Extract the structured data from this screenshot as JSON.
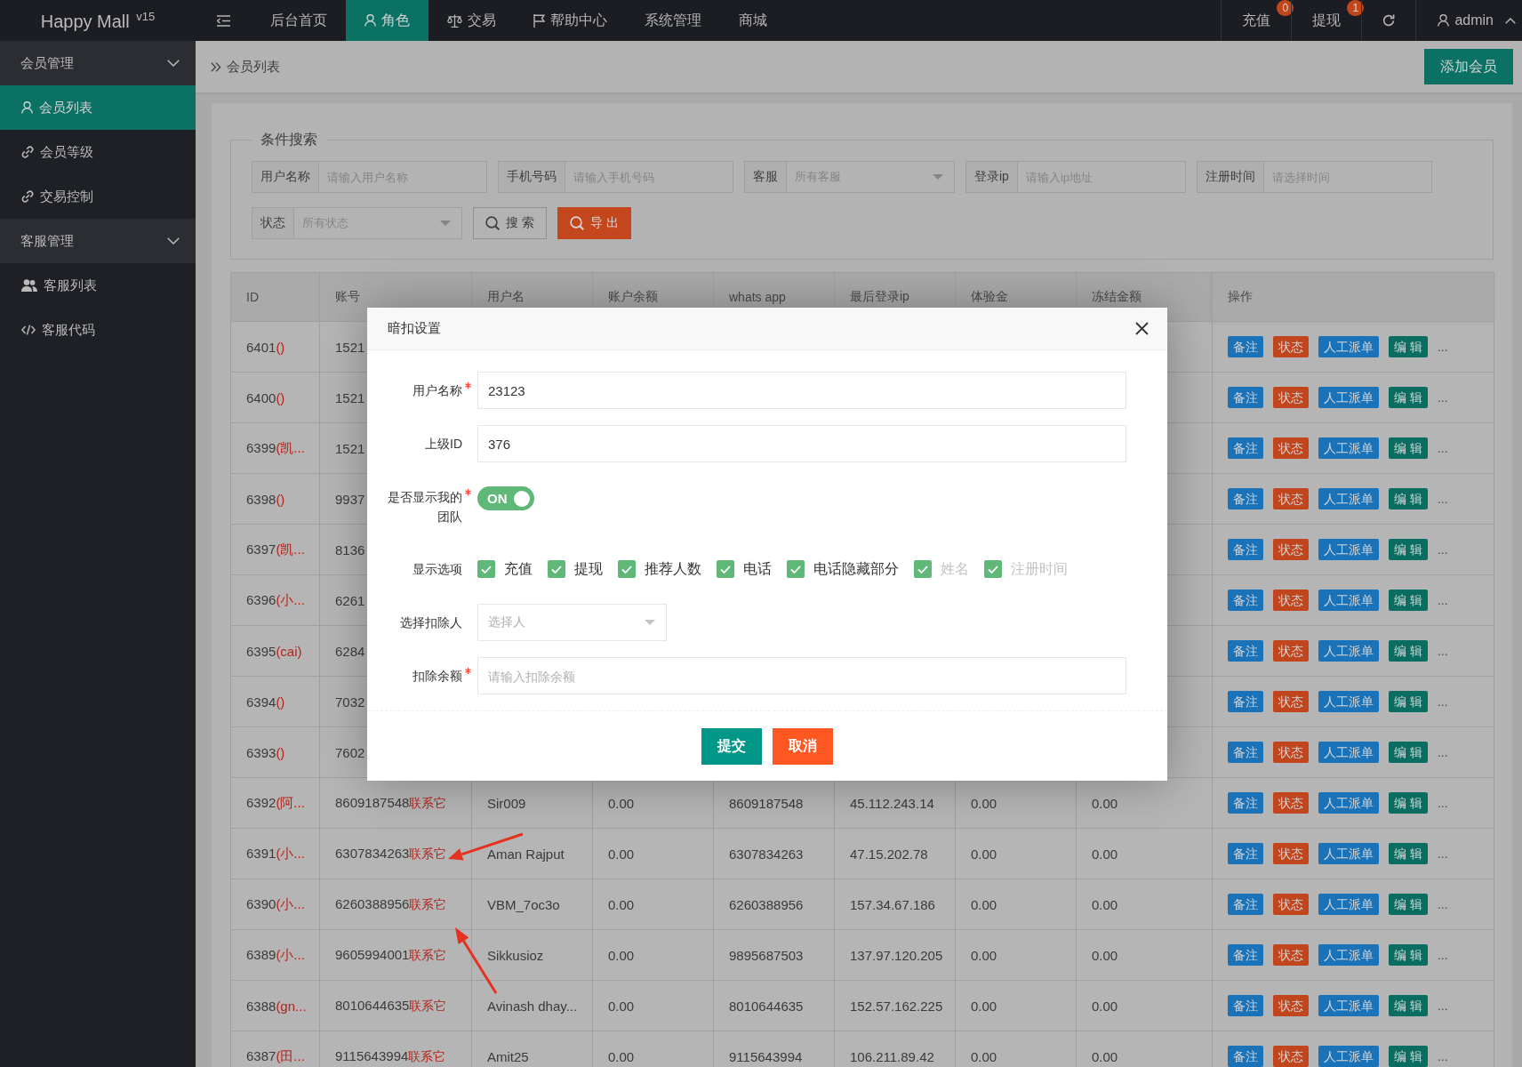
{
  "header": {
    "logo": "Happy Mall $^{v15}$",
    "nav": [
      {
        "label": "后台首页",
        "selected": false
      },
      {
        "label": "角色",
        "selected": true
      },
      {
        "label": "交易",
        "selected": false
      },
      {
        "label": "帮助中心",
        "selected": false
      },
      {
        "label": "系统管理",
        "selected": false
      },
      {
        "label": "商城",
        "selected": false
      }
    ],
    "actions": [
      {
        "kind": "link",
        "label": "充值",
        "badge": "0"
      },
      {
        "kind": "link",
        "label": "提现",
        "badge": "1"
      },
      {
        "kind": "refresh"
      },
      {
        "kind": "user",
        "label": "admin"
      }
    ]
  },
  "sidebar": [
    {
      "label": "会员管理",
      "expanded": true,
      "children": [
        {
          "label": "会员列表",
          "selected": true
        },
        {
          "label": "会员等级",
          "selected": false
        },
        {
          "label": "交易控制",
          "selected": false
        }
      ]
    },
    {
      "label": "客服管理",
      "expanded": true,
      "children": [
        {
          "label": "客服列表",
          "selected": false
        },
        {
          "label": "客服代码",
          "selected": false
        }
      ]
    }
  ],
  "breadcrumb": {
    "current": "会员列表",
    "button": "添加会员"
  },
  "search": {
    "legend": "条件搜索",
    "fields": [
      {
        "kind": "input",
        "label": "用户名称",
        "placeholder": "请输入用户名称"
      },
      {
        "kind": "input",
        "label": "手机号码",
        "placeholder": "请输入手机号码"
      },
      {
        "kind": "select",
        "label": "客服",
        "placeholder": "所有客服"
      },
      {
        "kind": "input",
        "label": "登录ip",
        "placeholder": "请输入ip地址"
      },
      {
        "kind": "input",
        "label": "注册时间",
        "placeholder": "请选择时间"
      },
      {
        "kind": "select",
        "label": "状态",
        "placeholder": "所有状态"
      }
    ],
    "buttons": [
      {
        "kind": "default",
        "label": "搜 索"
      },
      {
        "kind": "danger",
        "label": "导 出"
      }
    ]
  },
  "table": {
    "columns": [
      "ID",
      "账号",
      "用户名",
      "账户余额",
      "whats app",
      "最后登录ip",
      "体验金",
      "冻结金额",
      "操作"
    ],
    "rows": [
      {
        "id": "6401",
        "nick": "()",
        "account": "1521",
        "actions": [
          {
            "label": "备注",
            "kind": "normal"
          },
          {
            "label": "状态",
            "kind": "danger"
          },
          {
            "label": "人工派单",
            "kind": "normal"
          },
          {
            "label": "编 辑",
            "kind": "success"
          },
          {
            "label": "...",
            "kind": "more"
          }
        ]
      },
      {
        "id": "6400",
        "nick": "()",
        "account": "1521",
        "actions": [
          {
            "label": "备注",
            "kind": "normal"
          },
          {
            "label": "状态",
            "kind": "danger"
          },
          {
            "label": "人工派单",
            "kind": "normal"
          },
          {
            "label": "编 辑",
            "kind": "success"
          },
          {
            "label": "...",
            "kind": "more"
          }
        ]
      },
      {
        "id": "6399",
        "nick": "(凯...",
        "account": "1521",
        "actions": [
          {
            "label": "备注",
            "kind": "normal"
          },
          {
            "label": "状态",
            "kind": "danger"
          },
          {
            "label": "人工派单",
            "kind": "normal"
          },
          {
            "label": "编 辑",
            "kind": "success"
          },
          {
            "label": "...",
            "kind": "more"
          }
        ]
      },
      {
        "id": "6398",
        "nick": "()",
        "account": "9937",
        "actions": [
          {
            "label": "备注",
            "kind": "normal"
          },
          {
            "label": "状态",
            "kind": "danger"
          },
          {
            "label": "人工派单",
            "kind": "normal"
          },
          {
            "label": "编 辑",
            "kind": "success"
          },
          {
            "label": "...",
            "kind": "more"
          }
        ]
      },
      {
        "id": "6397",
        "nick": "(凯...",
        "account": "8136",
        "actions": [
          {
            "label": "备注",
            "kind": "normal"
          },
          {
            "label": "状态",
            "kind": "danger"
          },
          {
            "label": "人工派单",
            "kind": "normal"
          },
          {
            "label": "编 辑",
            "kind": "success"
          },
          {
            "label": "...",
            "kind": "more"
          }
        ]
      },
      {
        "id": "6396",
        "nick": "(小...",
        "account": "6261",
        "actions": [
          {
            "label": "备注",
            "kind": "normal"
          },
          {
            "label": "状态",
            "kind": "danger"
          },
          {
            "label": "人工派单",
            "kind": "normal"
          },
          {
            "label": "编 辑",
            "kind": "success"
          },
          {
            "label": "...",
            "kind": "more"
          }
        ]
      },
      {
        "id": "6395",
        "nick": "(cai)",
        "account": "6284",
        "actions": [
          {
            "label": "备注",
            "kind": "normal"
          },
          {
            "label": "状态",
            "kind": "danger"
          },
          {
            "label": "人工派单",
            "kind": "normal"
          },
          {
            "label": "编 辑",
            "kind": "success"
          },
          {
            "label": "...",
            "kind": "more"
          }
        ]
      },
      {
        "id": "6394",
        "nick": "()",
        "account": "7032",
        "actions": [
          {
            "label": "备注",
            "kind": "normal"
          },
          {
            "label": "状态",
            "kind": "danger"
          },
          {
            "label": "人工派单",
            "kind": "normal"
          },
          {
            "label": "编 辑",
            "kind": "success"
          },
          {
            "label": "...",
            "kind": "more"
          }
        ]
      },
      {
        "id": "6393",
        "nick": "()",
        "account": "7602",
        "actions": [
          {
            "label": "备注",
            "kind": "normal"
          },
          {
            "label": "状态",
            "kind": "danger"
          },
          {
            "label": "人工派单",
            "kind": "normal"
          },
          {
            "label": "编 辑",
            "kind": "success"
          },
          {
            "label": "...",
            "kind": "more"
          }
        ]
      },
      {
        "id": "6392",
        "nick": "(阿...",
        "account": "8609187548",
        "contact": "联系它",
        "username": "Sir009",
        "balance": "0.00",
        "whatsapp": "8609187548",
        "last_ip": "45.112.243.14",
        "trial": "0.00",
        "frozen": "0.00",
        "actions": [
          {
            "label": "备注",
            "kind": "normal"
          },
          {
            "label": "状态",
            "kind": "danger"
          },
          {
            "label": "人工派单",
            "kind": "normal"
          },
          {
            "label": "编 辑",
            "kind": "success"
          },
          {
            "label": "...",
            "kind": "more"
          }
        ]
      },
      {
        "id": "6391",
        "nick": "(小...",
        "account": "6307834263",
        "contact": "联系它",
        "annotation": {
          "kind": "arrow-upper-right"
        },
        "username": "Aman Rajput",
        "balance": "0.00",
        "whatsapp": "6307834263",
        "last_ip": "47.15.202.78",
        "trial": "0.00",
        "frozen": "0.00",
        "actions": [
          {
            "label": "备注",
            "kind": "normal"
          },
          {
            "label": "状态",
            "kind": "danger"
          },
          {
            "label": "人工派单",
            "kind": "normal"
          },
          {
            "label": "编 辑",
            "kind": "success"
          },
          {
            "label": "...",
            "kind": "more"
          }
        ]
      },
      {
        "id": "6390",
        "nick": "(小...",
        "account": "6260388956",
        "contact": "联系它",
        "annotation": {
          "kind": "arrow-below"
        },
        "username": "VBM_7oc3o",
        "balance": "0.00",
        "whatsapp": "6260388956",
        "last_ip": "157.34.67.186",
        "trial": "0.00",
        "frozen": "0.00",
        "actions": [
          {
            "label": "备注",
            "kind": "normal"
          },
          {
            "label": "状态",
            "kind": "danger"
          },
          {
            "label": "人工派单",
            "kind": "normal"
          },
          {
            "label": "编 辑",
            "kind": "success"
          },
          {
            "label": "...",
            "kind": "more"
          }
        ]
      },
      {
        "id": "6389",
        "nick": "(小...",
        "account": "9605994001",
        "contact": "联系它",
        "username": "Sikkusioz",
        "balance": "0.00",
        "whatsapp": "9895687503",
        "last_ip": "137.97.120.205",
        "trial": "0.00",
        "frozen": "0.00",
        "actions": [
          {
            "label": "备注",
            "kind": "normal"
          },
          {
            "label": "状态",
            "kind": "danger"
          },
          {
            "label": "人工派单",
            "kind": "normal"
          },
          {
            "label": "编 辑",
            "kind": "success"
          },
          {
            "label": "...",
            "kind": "more"
          }
        ]
      },
      {
        "id": "6388",
        "nick": "(gn...",
        "account": "8010644635",
        "contact": "联系它",
        "username": "Avinash dhay...",
        "balance": "0.00",
        "whatsapp": "8010644635",
        "last_ip": "152.57.162.225",
        "trial": "0.00",
        "frozen": "0.00",
        "actions": [
          {
            "label": "备注",
            "kind": "normal"
          },
          {
            "label": "状态",
            "kind": "danger"
          },
          {
            "label": "人工派单",
            "kind": "normal"
          },
          {
            "label": "编 辑",
            "kind": "success"
          },
          {
            "label": "...",
            "kind": "more"
          }
        ]
      },
      {
        "id": "6387",
        "nick": "(田...",
        "account": "9115643994",
        "contact": "联系它",
        "username": "Amit25",
        "balance": "0.00",
        "whatsapp": "9115643994",
        "last_ip": "106.211.89.42",
        "trial": "0.00",
        "frozen": "0.00",
        "actions": [
          {
            "label": "备注",
            "kind": "normal"
          },
          {
            "label": "状态",
            "kind": "danger"
          },
          {
            "label": "人工派单",
            "kind": "normal"
          },
          {
            "label": "编 辑",
            "kind": "success"
          },
          {
            "label": "...",
            "kind": "more"
          }
        ]
      }
    ]
  },
  "modal": {
    "title": "暗扣设置",
    "fields": [
      {
        "kind": "input",
        "label": "用户名称",
        "required": true,
        "value": "23123"
      },
      {
        "kind": "input",
        "label": "上级ID",
        "required": false,
        "value": "376"
      },
      {
        "kind": "switch",
        "label": "是否显示我的团队",
        "required": true,
        "on": true,
        "text": "ON"
      },
      {
        "kind": "checkboxes",
        "label": "显示选项",
        "required": false,
        "options": [
          {
            "label": "充值",
            "checked": true,
            "disabled": false
          },
          {
            "label": "提现",
            "checked": true,
            "disabled": false
          },
          {
            "label": "推荐人数",
            "checked": true,
            "disabled": false
          },
          {
            "label": "电话",
            "checked": true,
            "disabled": false
          },
          {
            "label": "电话隐藏部分",
            "checked": true,
            "disabled": false
          },
          {
            "label": "姓名",
            "checked": true,
            "disabled": true
          },
          {
            "label": "注册时间",
            "checked": true,
            "disabled": true
          }
        ]
      },
      {
        "kind": "select",
        "label": "选择扣除人",
        "required": false,
        "placeholder": "选择人"
      },
      {
        "kind": "input",
        "label": "扣除余额",
        "required": true,
        "placeholder": "请输入扣除余额"
      }
    ],
    "buttons": [
      {
        "kind": "primary",
        "label": "提交"
      },
      {
        "kind": "danger",
        "label": "取消"
      }
    ]
  }
}
